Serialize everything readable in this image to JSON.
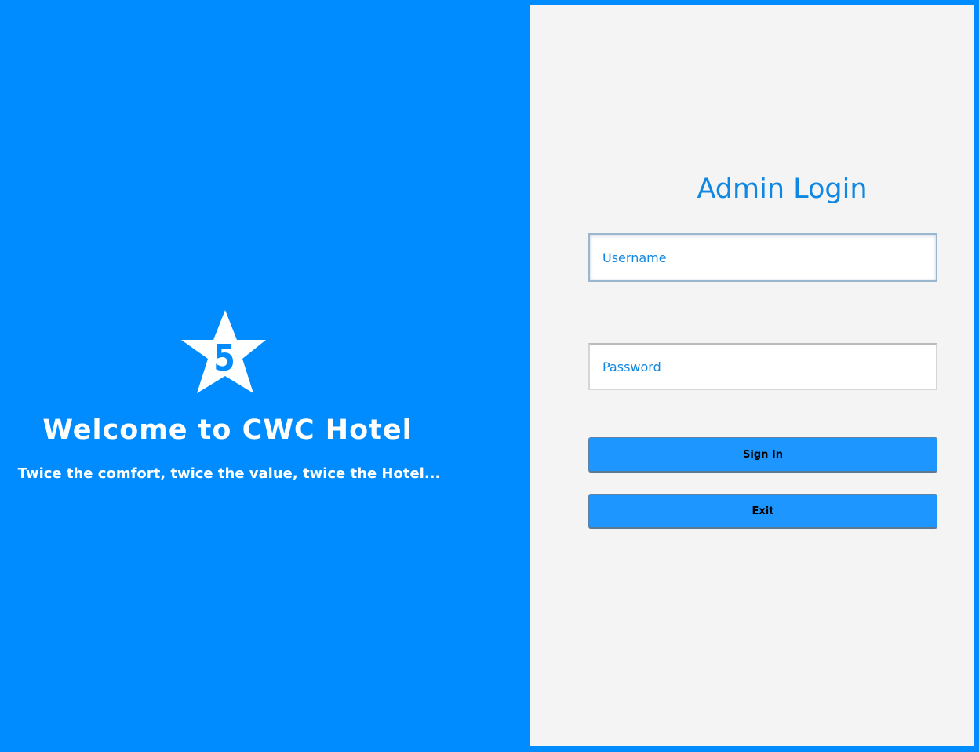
{
  "left": {
    "logo_number": "5",
    "welcome_title": "Welcome to CWC Hotel",
    "tagline": "Twice the comfort, twice the value, twice the Hotel..."
  },
  "login": {
    "title": "Admin Login",
    "username_value": "Username",
    "password_value": "Password",
    "signin_label": "Sign In",
    "exit_label": "Exit"
  },
  "colors": {
    "background_blue": "#008cff",
    "panel": "#f4f4f4",
    "accent_text": "#0f87e3",
    "button": "#1d97ff"
  },
  "icons": {
    "logo": "star-five-icon"
  }
}
